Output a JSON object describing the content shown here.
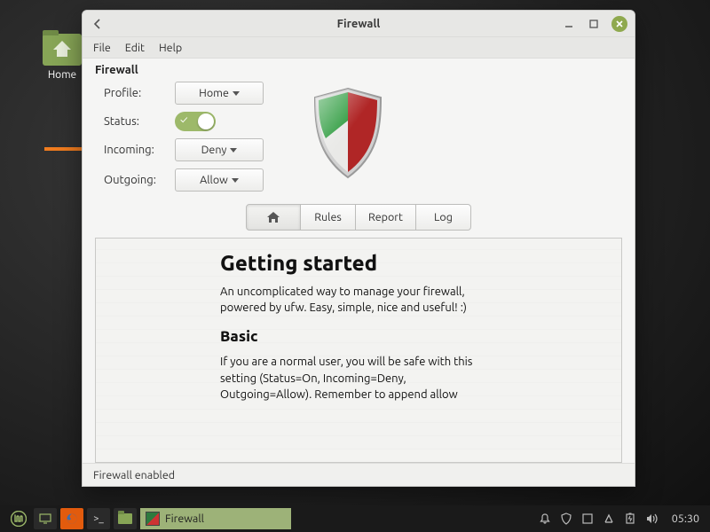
{
  "desktop": {
    "home_label": "Home"
  },
  "window": {
    "title": "Firewall",
    "menu": {
      "file": "File",
      "edit": "Edit",
      "help": "Help"
    },
    "section": "Firewall",
    "labels": {
      "profile": "Profile:",
      "status": "Status:",
      "incoming": "Incoming:",
      "outgoing": "Outgoing:"
    },
    "values": {
      "profile": "Home",
      "incoming": "Deny",
      "outgoing": "Allow"
    },
    "status_on": true,
    "tabs": {
      "home": "",
      "rules": "Rules",
      "report": "Report",
      "log": "Log"
    },
    "doc": {
      "h1": "Getting started",
      "p1": "An uncomplicated way to manage your firewall, powered by ufw. Easy, simple, nice and useful! :)",
      "h2": "Basic",
      "p2": "If you are a normal user, you will be safe with this setting (Status=On, Incoming=Deny, Outgoing=Allow). Remember to append allow"
    },
    "statusbar": "Firewall enabled"
  },
  "taskbar": {
    "active_task": "Firewall",
    "clock": "05:30"
  },
  "colors": {
    "accent": "#8fa94e"
  }
}
